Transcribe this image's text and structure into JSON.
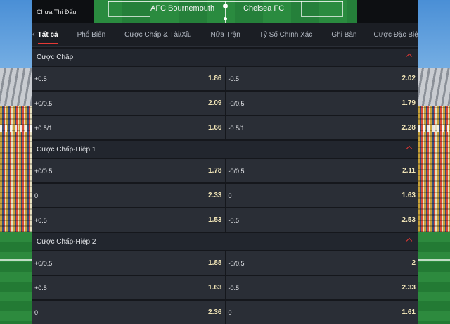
{
  "match": {
    "status": "Chưa Thi Đấu",
    "home_team": "AFC Bournemouth",
    "away_team": "Chelsea FC"
  },
  "tabs": [
    {
      "label": "Tất cả",
      "active": true
    },
    {
      "label": "Phổ Biến"
    },
    {
      "label": "Cược Chấp & Tài/Xỉu"
    },
    {
      "label": "Nửa Trận"
    },
    {
      "label": "Tỷ Số Chính Xác"
    },
    {
      "label": "Ghi Bàn"
    },
    {
      "label": "Cược Đặc Biệt"
    }
  ],
  "nav": {
    "prev_icon": "chevron-left-icon",
    "next_icon": "chevron-right-icon"
  },
  "colors": {
    "accent": "#e53935",
    "odds": "#f2e6b8",
    "panel": "#15171c",
    "cell": "#2a2e36"
  },
  "sections": [
    {
      "title": "Cược Chấp",
      "rows": [
        [
          {
            "line": "+0.5",
            "odd": "1.86"
          },
          {
            "line": "-0.5",
            "odd": "2.02"
          }
        ],
        [
          {
            "line": "+0/0.5",
            "odd": "2.09"
          },
          {
            "line": "-0/0.5",
            "odd": "1.79"
          }
        ],
        [
          {
            "line": "+0.5/1",
            "odd": "1.66"
          },
          {
            "line": "-0.5/1",
            "odd": "2.28"
          }
        ]
      ]
    },
    {
      "title": "Cược Chấp-Hiệp 1",
      "rows": [
        [
          {
            "line": "+0/0.5",
            "odd": "1.78"
          },
          {
            "line": "-0/0.5",
            "odd": "2.11"
          }
        ],
        [
          {
            "line": "0",
            "odd": "2.33"
          },
          {
            "line": "0",
            "odd": "1.63"
          }
        ],
        [
          {
            "line": "+0.5",
            "odd": "1.53"
          },
          {
            "line": "-0.5",
            "odd": "2.53"
          }
        ]
      ]
    },
    {
      "title": "Cược Chấp-Hiệp 2",
      "rows": [
        [
          {
            "line": "+0/0.5",
            "odd": "1.88"
          },
          {
            "line": "-0/0.5",
            "odd": "2"
          }
        ],
        [
          {
            "line": "+0.5",
            "odd": "1.63"
          },
          {
            "line": "-0.5",
            "odd": "2.33"
          }
        ],
        [
          {
            "line": "0",
            "odd": "2.36"
          },
          {
            "line": "0",
            "odd": "1.61"
          }
        ]
      ]
    }
  ]
}
